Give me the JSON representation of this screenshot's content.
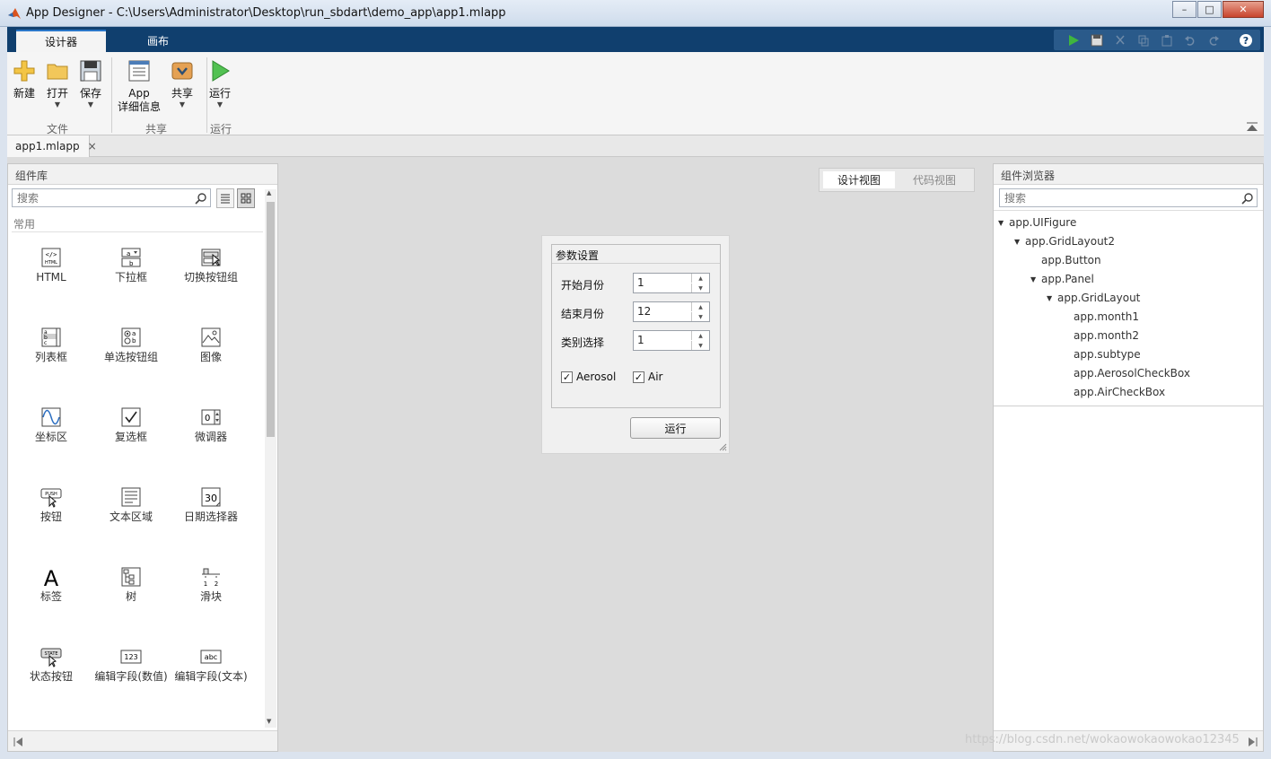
{
  "window": {
    "title": "App Designer - C:\\Users\\Administrator\\Desktop\\run_sbdart\\demo_app\\app1.mlapp",
    "controls": {
      "minimize": "–",
      "maximize": "□",
      "close": "✕"
    }
  },
  "ribbon": {
    "tabs": [
      {
        "label": "设计器"
      },
      {
        "label": "画布"
      }
    ],
    "buttons": {
      "new": "新建",
      "open": "打开",
      "save": "保存",
      "app_details_line1": "App",
      "app_details_line2": "详细信息",
      "share": "共享",
      "run": "运行"
    },
    "groups": {
      "file": "文件",
      "share": "共享",
      "run": "运行"
    },
    "accent_color": "#103f6e"
  },
  "document": {
    "tab_label": "app1.mlapp",
    "close": "×"
  },
  "component_library": {
    "title": "组件库",
    "search_placeholder": "搜索",
    "section": "常用",
    "items": [
      {
        "label": "HTML",
        "icon": "html-icon"
      },
      {
        "label": "下拉框",
        "icon": "dropdown-icon"
      },
      {
        "label": "切换按钮组",
        "icon": "toggle-button-group-icon"
      },
      {
        "label": "列表框",
        "icon": "listbox-icon"
      },
      {
        "label": "单选按钮组",
        "icon": "radio-button-group-icon"
      },
      {
        "label": "图像",
        "icon": "image-icon"
      },
      {
        "label": "坐标区",
        "icon": "axes-icon"
      },
      {
        "label": "复选框",
        "icon": "checkbox-icon"
      },
      {
        "label": "微调器",
        "icon": "spinner-icon"
      },
      {
        "label": "按钮",
        "icon": "push-button-icon"
      },
      {
        "label": "文本区域",
        "icon": "text-area-icon"
      },
      {
        "label": "日期选择器",
        "icon": "date-picker-icon"
      },
      {
        "label": "标签",
        "icon": "label-icon"
      },
      {
        "label": "树",
        "icon": "tree-icon"
      },
      {
        "label": "滑块",
        "icon": "slider-icon"
      },
      {
        "label": "状态按钮",
        "icon": "state-button-icon"
      },
      {
        "label": "编辑字段(数值)",
        "icon": "numeric-field-icon"
      },
      {
        "label": "编辑字段(文本)",
        "icon": "text-field-icon"
      }
    ]
  },
  "canvas": {
    "view_toggle": {
      "design": "设计视图",
      "code": "代码视图"
    },
    "panel_title": "参数设置",
    "fields": [
      {
        "label": "开始月份",
        "value": "1"
      },
      {
        "label": "结束月份",
        "value": "12"
      },
      {
        "label": "类别选择",
        "value": "1"
      }
    ],
    "checkboxes": [
      {
        "label": "Aerosol",
        "checked": true
      },
      {
        "label": "Air",
        "checked": true
      }
    ],
    "run_button": "运行"
  },
  "component_browser": {
    "title": "组件浏览器",
    "search_placeholder": "搜索",
    "tree": [
      {
        "label": "app.UIFigure"
      },
      {
        "label": "app.GridLayout2"
      },
      {
        "label": "app.Button"
      },
      {
        "label": "app.Panel"
      },
      {
        "label": "app.GridLayout"
      },
      {
        "label": "app.month1"
      },
      {
        "label": "app.month2"
      },
      {
        "label": "app.subtype"
      },
      {
        "label": "app.AerosolCheckBox"
      },
      {
        "label": "app.AirCheckBox"
      }
    ]
  },
  "watermark": "https://blog.csdn.net/wokaowokaowokao12345"
}
